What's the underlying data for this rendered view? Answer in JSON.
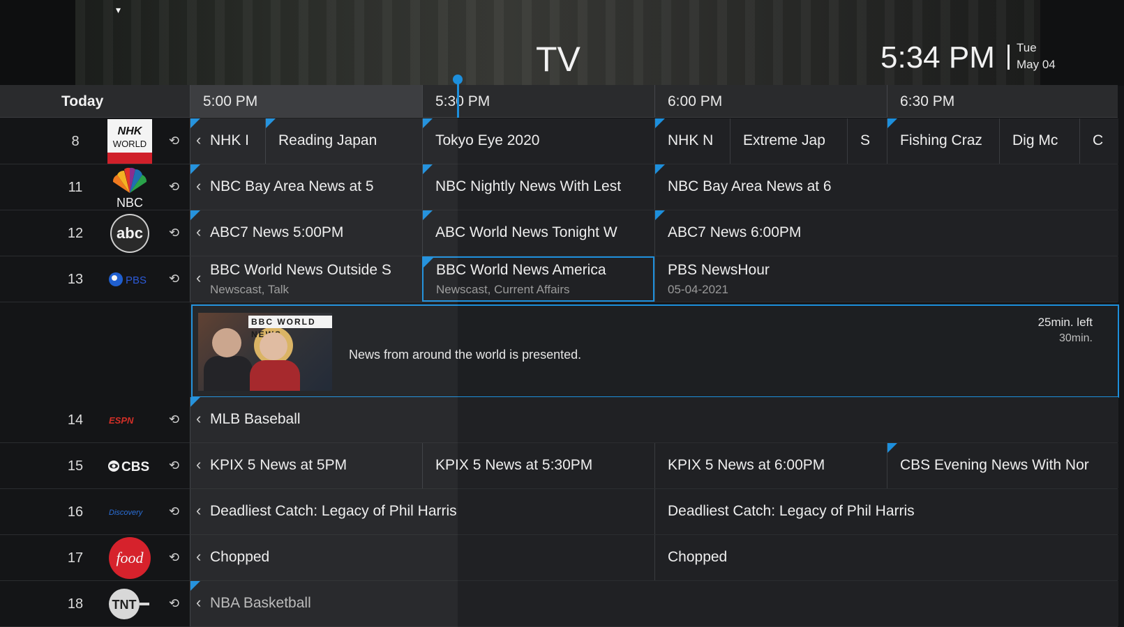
{
  "header": {
    "title": "TV",
    "time": "5:34 PM",
    "day": "Tue",
    "date": "May 04"
  },
  "timebar": {
    "today_label": "Today",
    "slots": [
      "5:00 PM",
      "5:30 PM",
      "6:00 PM",
      "6:30 PM"
    ]
  },
  "rows": [
    {
      "number": "8",
      "logo": "NHK WORLD JAPAN",
      "programs": [
        "NHK I",
        "Reading Japan",
        "Tokyo Eye 2020",
        "NHK N",
        "Extreme Jap",
        "S",
        "Fishing Craz",
        "Dig Mc",
        "C"
      ]
    },
    {
      "number": "11",
      "logo": "NBC",
      "programs": [
        "NBC Bay Area News at 5",
        "NBC Nightly News With Lest",
        "NBC Bay Area News at 6"
      ]
    },
    {
      "number": "12",
      "logo": "abc",
      "programs": [
        "ABC7 News 5:00PM",
        "ABC World News Tonight W",
        "ABC7 News 6:00PM"
      ]
    },
    {
      "number": "13",
      "logo": "PBS",
      "programs": [
        {
          "title": "BBC World News Outside S",
          "sub": "Newscast, Talk"
        },
        {
          "title": "BBC World News America",
          "sub": "Newscast, Current Affairs"
        },
        {
          "title": "PBS NewsHour",
          "sub": "05-04-2021"
        }
      ]
    },
    {
      "number": "14",
      "logo": "ESPN",
      "programs": [
        "MLB Baseball"
      ]
    },
    {
      "number": "15",
      "logo": "CBS",
      "programs": [
        "KPIX 5 News at 5PM",
        "KPIX 5 News at 5:30PM",
        "KPIX 5 News at 6:00PM",
        "CBS Evening News With Nor"
      ]
    },
    {
      "number": "16",
      "logo": "Discovery",
      "programs": [
        "Deadliest Catch: Legacy of Phil Harris",
        "Deadliest Catch: Legacy of Phil Harris"
      ]
    },
    {
      "number": "17",
      "logo": "food",
      "programs": [
        "Chopped",
        "Chopped"
      ]
    },
    {
      "number": "18",
      "logo": "TNT",
      "programs": [
        "NBA Basketball"
      ]
    }
  ],
  "detail": {
    "thumbnail_badge": "BBC WORLD NEWS",
    "description": "News from around the world is presented.",
    "time_left": "25min. left",
    "duration": "30min."
  },
  "colors": {
    "accent": "#1d8fdc",
    "background": "#141517",
    "cell": "#202124"
  }
}
